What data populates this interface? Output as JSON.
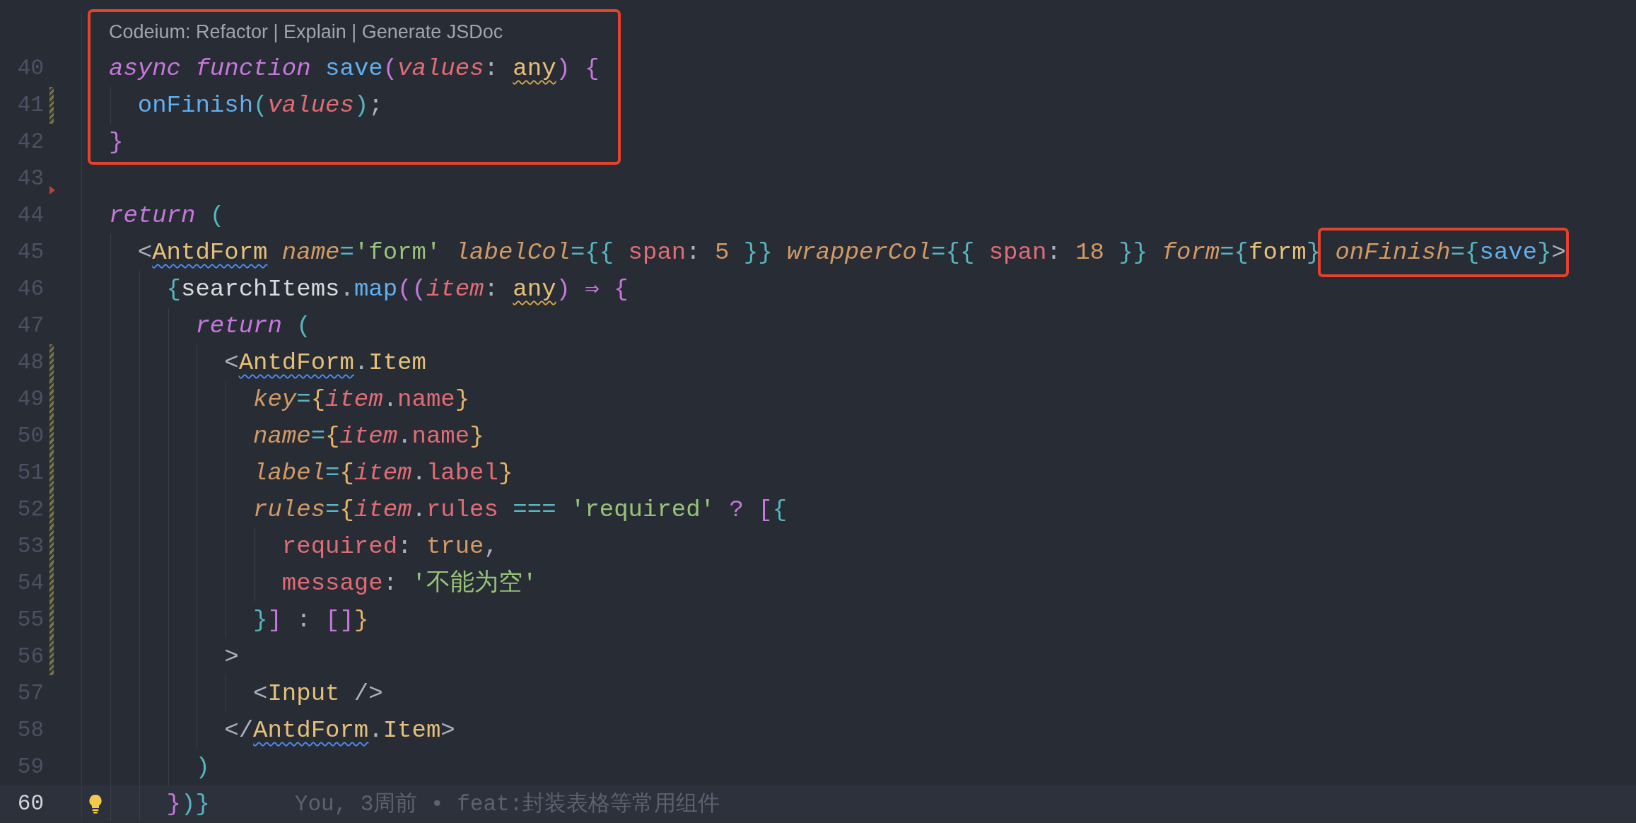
{
  "code_lens": {
    "text": "Codeium: Refactor | Explain | Generate JSDoc",
    "framed": true
  },
  "lines": [
    {
      "number": "40",
      "framed": true,
      "tokens": [
        {
          "text": "async",
          "kind": "keyword"
        },
        {
          "text": " function",
          "kind": "keyword"
        },
        {
          "text": " save",
          "kind": "function"
        },
        {
          "text": "(",
          "kind": "bracket1"
        },
        {
          "text": "values",
          "kind": "param"
        },
        {
          "text": ": ",
          "kind": "punct"
        },
        {
          "text": "any",
          "kind": "type",
          "warned": true
        },
        {
          "text": ")",
          "kind": "bracket1"
        },
        {
          "text": " {",
          "kind": "bracket1"
        }
      ]
    },
    {
      "number": "41",
      "framed": true,
      "changed": true,
      "tokens": [
        {
          "text": "  onFinish",
          "kind": "function"
        },
        {
          "text": "(",
          "kind": "bracket2"
        },
        {
          "text": "values",
          "kind": "param"
        },
        {
          "text": ")",
          "kind": "bracket2"
        },
        {
          "text": ";",
          "kind": "punct"
        }
      ]
    },
    {
      "number": "42",
      "framed": true,
      "tokens": [
        {
          "text": "}",
          "kind": "bracket1"
        }
      ]
    },
    {
      "number": "43",
      "flagged": true
    },
    {
      "number": "44",
      "tokens": [
        {
          "text": "return",
          "kind": "keyword"
        },
        {
          "text": " (",
          "kind": "bracket2"
        }
      ]
    },
    {
      "number": "45",
      "tokens": [
        {
          "text": "  <",
          "kind": "punct"
        },
        {
          "text": "AntdForm",
          "kind": "tag",
          "misspelled": true
        },
        {
          "text": " name",
          "kind": "attr"
        },
        {
          "text": "=",
          "kind": "operator"
        },
        {
          "text": "'form'",
          "kind": "string"
        },
        {
          "text": " labelCol",
          "kind": "attr"
        },
        {
          "text": "=",
          "kind": "operator"
        },
        {
          "text": "{{",
          "kind": "bracket2"
        },
        {
          "text": " span",
          "kind": "prop"
        },
        {
          "text": ":",
          "kind": "punct"
        },
        {
          "text": " 5",
          "kind": "number"
        },
        {
          "text": " }}",
          "kind": "bracket2"
        },
        {
          "text": " wrapperCol",
          "kind": "attr"
        },
        {
          "text": "=",
          "kind": "operator"
        },
        {
          "text": "{{",
          "kind": "bracket2"
        },
        {
          "text": " span",
          "kind": "prop"
        },
        {
          "text": ":",
          "kind": "punct"
        },
        {
          "text": " 18",
          "kind": "number"
        },
        {
          "text": " }}",
          "kind": "bracket2"
        },
        {
          "text": " form",
          "kind": "attr"
        },
        {
          "text": "=",
          "kind": "operator"
        },
        {
          "text": "{",
          "kind": "bracket2"
        },
        {
          "text": "form",
          "kind": "variable"
        },
        {
          "text": "}",
          "kind": "bracket2"
        },
        {
          "text": " onFinish",
          "kind": "attr",
          "framed": true
        },
        {
          "text": "=",
          "kind": "operator",
          "framed": true
        },
        {
          "text": "{",
          "kind": "bracket2",
          "framed": true
        },
        {
          "text": "save",
          "kind": "function",
          "framed": true
        },
        {
          "text": "}",
          "kind": "bracket2",
          "framed": true
        },
        {
          "text": ">",
          "kind": "punct",
          "framed": true
        }
      ]
    },
    {
      "number": "46",
      "tokens": [
        {
          "text": "    {",
          "kind": "bracket2"
        },
        {
          "text": "searchItems",
          "kind": "identifier"
        },
        {
          "text": ".",
          "kind": "punct"
        },
        {
          "text": "map",
          "kind": "function"
        },
        {
          "text": "((",
          "kind": "bracket1"
        },
        {
          "text": "item",
          "kind": "param"
        },
        {
          "text": ": ",
          "kind": "punct"
        },
        {
          "text": "any",
          "kind": "type",
          "warned": true
        },
        {
          "text": ")",
          "kind": "bracket1"
        },
        {
          "text": " ⇒",
          "kind": "bracket1"
        },
        {
          "text": " {",
          "kind": "bracket1"
        }
      ]
    },
    {
      "number": "47",
      "tokens": [
        {
          "text": "      return",
          "kind": "keyword"
        },
        {
          "text": " (",
          "kind": "bracket2"
        }
      ]
    },
    {
      "number": "48",
      "changed": true,
      "tokens": [
        {
          "text": "        <",
          "kind": "punct"
        },
        {
          "text": "AntdForm",
          "kind": "tag",
          "misspelled": true
        },
        {
          "text": ".",
          "kind": "punct"
        },
        {
          "text": "Item",
          "kind": "tag"
        }
      ]
    },
    {
      "number": "49",
      "changed": true,
      "tokens": [
        {
          "text": "          key",
          "kind": "attr"
        },
        {
          "text": "=",
          "kind": "operator"
        },
        {
          "text": "{",
          "kind": "bracket3"
        },
        {
          "text": "item",
          "kind": "param"
        },
        {
          "text": ".",
          "kind": "punct"
        },
        {
          "text": "name",
          "kind": "prop"
        },
        {
          "text": "}",
          "kind": "bracket3"
        }
      ]
    },
    {
      "number": "50",
      "changed": true,
      "tokens": [
        {
          "text": "          name",
          "kind": "attr"
        },
        {
          "text": "=",
          "kind": "operator"
        },
        {
          "text": "{",
          "kind": "bracket3"
        },
        {
          "text": "item",
          "kind": "param"
        },
        {
          "text": ".",
          "kind": "punct"
        },
        {
          "text": "name",
          "kind": "prop"
        },
        {
          "text": "}",
          "kind": "bracket3"
        }
      ]
    },
    {
      "number": "51",
      "changed": true,
      "tokens": [
        {
          "text": "          label",
          "kind": "attr"
        },
        {
          "text": "=",
          "kind": "operator"
        },
        {
          "text": "{",
          "kind": "bracket3"
        },
        {
          "text": "item",
          "kind": "param"
        },
        {
          "text": ".",
          "kind": "punct"
        },
        {
          "text": "label",
          "kind": "prop"
        },
        {
          "text": "}",
          "kind": "bracket3"
        }
      ]
    },
    {
      "number": "52",
      "changed": true,
      "tokens": [
        {
          "text": "          rules",
          "kind": "attr"
        },
        {
          "text": "=",
          "kind": "operator"
        },
        {
          "text": "{",
          "kind": "bracket3"
        },
        {
          "text": "item",
          "kind": "param"
        },
        {
          "text": ".",
          "kind": "punct"
        },
        {
          "text": "rules",
          "kind": "prop"
        },
        {
          "text": " ===",
          "kind": "operator"
        },
        {
          "text": " 'required'",
          "kind": "string"
        },
        {
          "text": " ?",
          "kind": "bracket1"
        },
        {
          "text": " [",
          "kind": "bracket1"
        },
        {
          "text": "{",
          "kind": "bracket2"
        }
      ]
    },
    {
      "number": "53",
      "changed": true,
      "tokens": [
        {
          "text": "            required",
          "kind": "prop"
        },
        {
          "text": ":",
          "kind": "punct"
        },
        {
          "text": " true",
          "kind": "number"
        },
        {
          "text": ",",
          "kind": "punct"
        }
      ]
    },
    {
      "number": "54",
      "changed": true,
      "tokens": [
        {
          "text": "            message",
          "kind": "prop"
        },
        {
          "text": ":",
          "kind": "punct"
        },
        {
          "text": " '不能为空'",
          "kind": "string"
        }
      ]
    },
    {
      "number": "55",
      "changed": true,
      "tokens": [
        {
          "text": "          }",
          "kind": "bracket2"
        },
        {
          "text": "]",
          "kind": "bracket1"
        },
        {
          "text": " :",
          "kind": "punct"
        },
        {
          "text": " []",
          "kind": "bracket1"
        },
        {
          "text": "}",
          "kind": "bracket3"
        }
      ]
    },
    {
      "number": "56",
      "changed": true,
      "tokens": [
        {
          "text": "        >",
          "kind": "punct"
        }
      ]
    },
    {
      "number": "57",
      "tokens": [
        {
          "text": "          <",
          "kind": "punct"
        },
        {
          "text": "Input",
          "kind": "tag"
        },
        {
          "text": " />",
          "kind": "punct"
        }
      ]
    },
    {
      "number": "58",
      "tokens": [
        {
          "text": "        </",
          "kind": "punct"
        },
        {
          "text": "AntdForm",
          "kind": "tag",
          "misspelled": true
        },
        {
          "text": ".",
          "kind": "punct"
        },
        {
          "text": "Item",
          "kind": "tag"
        },
        {
          "text": ">",
          "kind": "punct"
        }
      ]
    },
    {
      "number": "59",
      "tokens": [
        {
          "text": "      )",
          "kind": "bracket2"
        }
      ]
    },
    {
      "number": "60",
      "current": true,
      "intention": true,
      "blame": "You, 3周前 • feat:封装表格等常用组件",
      "tokens": [
        {
          "text": "    }",
          "kind": "bracket1"
        },
        {
          "text": ")",
          "kind": "bracket2"
        },
        {
          "text": "}",
          "kind": "bracket2"
        }
      ]
    }
  ]
}
